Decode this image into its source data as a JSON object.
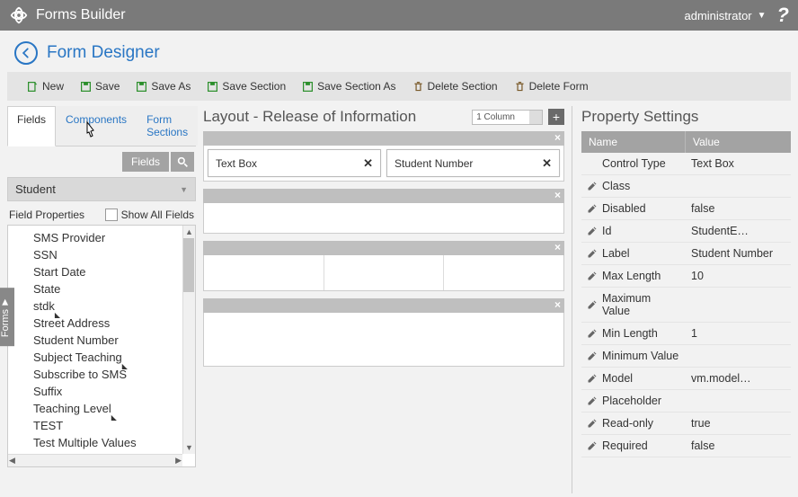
{
  "app": {
    "title": "Forms Builder",
    "user": "administrator"
  },
  "page": {
    "title": "Form Designer"
  },
  "toolbar": {
    "new": "New",
    "save": "Save",
    "save_as": "Save As",
    "save_section": "Save Section",
    "save_section_as": "Save Section As",
    "delete_section": "Delete Section",
    "delete_form": "Delete Form"
  },
  "tabs": {
    "fields": "Fields",
    "components": "Components",
    "form_sections": "Form Sections",
    "active": "Fields"
  },
  "search": {
    "label": "Fields"
  },
  "entity_select": {
    "value": "Student"
  },
  "field_props": {
    "heading": "Field Properties",
    "show_all": "Show All Fields",
    "show_all_checked": false
  },
  "field_list": [
    {
      "label": "SMS Provider"
    },
    {
      "label": "SSN"
    },
    {
      "label": "Start Date"
    },
    {
      "label": "State"
    },
    {
      "label": "stdk",
      "tag": true
    },
    {
      "label": "Street Address"
    },
    {
      "label": "Student Number"
    },
    {
      "label": "Subject Teaching",
      "tag": true
    },
    {
      "label": "Subscribe to SMS"
    },
    {
      "label": "Suffix"
    },
    {
      "label": "Teaching Level",
      "tag": true
    },
    {
      "label": "TEST"
    },
    {
      "label": "Test Multiple Values"
    }
  ],
  "side_tab": "Forms",
  "layout": {
    "title": "Layout - Release of Information",
    "columns_select": "1 Column",
    "field_box_1": "Text Box",
    "field_box_2": "Student Number"
  },
  "properties": {
    "title": "Property Settings",
    "header": {
      "name": "Name",
      "value": "Value"
    },
    "rows": [
      {
        "name": "Control Type",
        "value": "Text Box",
        "editable": false
      },
      {
        "name": "Class",
        "value": "",
        "editable": true
      },
      {
        "name": "Disabled",
        "value": "false",
        "editable": true
      },
      {
        "name": "Id",
        "value": "StudentE…",
        "editable": true
      },
      {
        "name": "Label",
        "value": "Student Number",
        "editable": true
      },
      {
        "name": "Max Length",
        "value": "10",
        "editable": true
      },
      {
        "name": "Maximum Value",
        "value": "",
        "editable": true
      },
      {
        "name": "Min Length",
        "value": "1",
        "editable": true
      },
      {
        "name": "Minimum Value",
        "value": "",
        "editable": true
      },
      {
        "name": "Model",
        "value": "vm.model…",
        "editable": true
      },
      {
        "name": "Placeholder",
        "value": "",
        "editable": true
      },
      {
        "name": "Read-only",
        "value": "true",
        "editable": true
      },
      {
        "name": "Required",
        "value": "false",
        "editable": true
      }
    ]
  }
}
